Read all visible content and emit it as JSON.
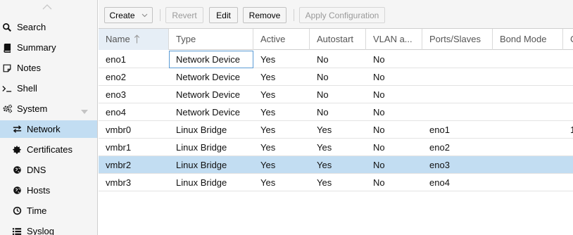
{
  "sidebar": {
    "items": [
      {
        "label": "Search",
        "icon": "search-icon",
        "level": "top"
      },
      {
        "label": "Summary",
        "icon": "book-icon",
        "level": "top"
      },
      {
        "label": "Notes",
        "icon": "note-icon",
        "level": "top"
      },
      {
        "label": "Shell",
        "icon": "terminal-icon",
        "level": "top"
      },
      {
        "label": "System",
        "icon": "gears-icon",
        "level": "top",
        "expanded": true
      },
      {
        "label": "Network",
        "icon": "exchange-icon",
        "level": "sub",
        "selected": true
      },
      {
        "label": "Certificates",
        "icon": "certificate-icon",
        "level": "sub"
      },
      {
        "label": "DNS",
        "icon": "globe-icon",
        "level": "sub"
      },
      {
        "label": "Hosts",
        "icon": "globe-icon",
        "level": "sub"
      },
      {
        "label": "Time",
        "icon": "clock-icon",
        "level": "sub"
      },
      {
        "label": "Syslog",
        "icon": "list-icon",
        "level": "sub"
      }
    ]
  },
  "toolbar": {
    "create_label": "Create",
    "revert_label": "Revert",
    "edit_label": "Edit",
    "remove_label": "Remove",
    "apply_label": "Apply Configuration"
  },
  "grid": {
    "columns": [
      "Name",
      "Type",
      "Active",
      "Autostart",
      "VLAN a...",
      "Ports/Slaves",
      "Bond Mode",
      "C"
    ],
    "sorted_column": "Name",
    "sort_direction": "ascending",
    "rows": [
      [
        "eno1",
        "Network Device",
        "Yes",
        "No",
        "No",
        "",
        "",
        ""
      ],
      [
        "eno2",
        "Network Device",
        "Yes",
        "No",
        "No",
        "",
        "",
        ""
      ],
      [
        "eno3",
        "Network Device",
        "Yes",
        "No",
        "No",
        "",
        "",
        ""
      ],
      [
        "eno4",
        "Network Device",
        "Yes",
        "No",
        "No",
        "",
        "",
        ""
      ],
      [
        "vmbr0",
        "Linux Bridge",
        "Yes",
        "Yes",
        "No",
        "eno1",
        "",
        "1"
      ],
      [
        "vmbr1",
        "Linux Bridge",
        "Yes",
        "Yes",
        "No",
        "eno2",
        "",
        ""
      ],
      [
        "vmbr2",
        "Linux Bridge",
        "Yes",
        "Yes",
        "No",
        "eno3",
        "",
        ""
      ],
      [
        "vmbr3",
        "Linux Bridge",
        "Yes",
        "Yes",
        "No",
        "eno4",
        "",
        ""
      ]
    ],
    "selected_row": 6,
    "focused_cell": [
      0,
      1
    ]
  },
  "colors": {
    "selection": "#c2ddf2",
    "panel_bg": "#f5f5f5",
    "border": "#cfcfcf"
  }
}
